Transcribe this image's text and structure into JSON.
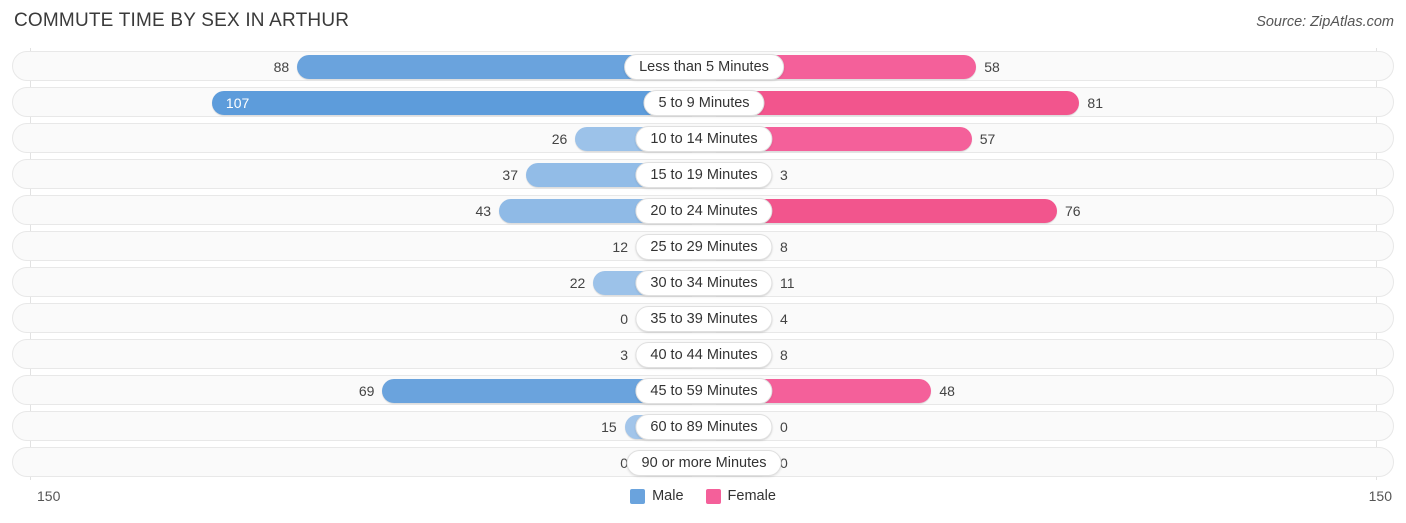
{
  "header": {
    "title": "COMMUTE TIME BY SEX IN ARTHUR",
    "source": "Source: ZipAtlas.com"
  },
  "axis": {
    "left_tick": "150",
    "right_tick": "150",
    "max": 150
  },
  "legend": {
    "items": [
      {
        "label": "Male",
        "color": "#6aa3dd"
      },
      {
        "label": "Female",
        "color": "#f4609a"
      }
    ]
  },
  "colors": {
    "male_strong": "#6aa3dd",
    "male_mid": "#8fbae6",
    "male_light": "#aecbec",
    "female_strong": "#f25d92",
    "female_mid": "#f579a8",
    "female_light": "#f9aec8",
    "track": "#fafafa",
    "track_border": "#e8e8e8"
  },
  "chart_data": {
    "type": "bar",
    "title": "COMMUTE TIME BY SEX IN ARTHUR",
    "subtitle": "",
    "orientation": "horizontal-diverging",
    "xlabel": "",
    "ylabel": "",
    "xlim": [
      150,
      150
    ],
    "grid": false,
    "legend_position": "bottom-center",
    "categories": [
      "Less than 5 Minutes",
      "5 to 9 Minutes",
      "10 to 14 Minutes",
      "15 to 19 Minutes",
      "20 to 24 Minutes",
      "25 to 29 Minutes",
      "30 to 34 Minutes",
      "35 to 39 Minutes",
      "40 to 44 Minutes",
      "45 to 59 Minutes",
      "60 to 89 Minutes",
      "90 or more Minutes"
    ],
    "series": [
      {
        "name": "Male",
        "values": [
          88,
          107,
          26,
          37,
          43,
          12,
          22,
          0,
          3,
          69,
          15,
          0
        ]
      },
      {
        "name": "Female",
        "values": [
          58,
          81,
          57,
          3,
          76,
          8,
          11,
          4,
          8,
          48,
          0,
          0
        ]
      }
    ]
  },
  "rows": [
    {
      "category": "Less than 5 Minutes",
      "male": "88",
      "female": "58",
      "male_value": 88,
      "female_value": 58,
      "male_inside": false,
      "male_color": "#6aa3dd",
      "female_color": "#f4609a"
    },
    {
      "category": "5 to 9 Minutes",
      "male": "107",
      "female": "81",
      "male_value": 107,
      "female_value": 81,
      "male_inside": true,
      "male_color": "#5d9cdb",
      "female_color": "#f2558d"
    },
    {
      "category": "10 to 14 Minutes",
      "male": "26",
      "female": "57",
      "male_value": 26,
      "female_value": 57,
      "male_inside": false,
      "male_color": "#9cc2e9",
      "female_color": "#f4609a"
    },
    {
      "category": "15 to 19 Minutes",
      "male": "37",
      "female": "3",
      "male_value": 37,
      "female_value": 3,
      "male_inside": false,
      "male_color": "#92bce7",
      "female_color": "#f9aec8"
    },
    {
      "category": "20 to 24 Minutes",
      "male": "43",
      "female": "76",
      "male_value": 43,
      "female_value": 76,
      "male_inside": false,
      "male_color": "#8fbae6",
      "female_color": "#f2558d"
    },
    {
      "category": "25 to 29 Minutes",
      "male": "12",
      "female": "8",
      "male_value": 12,
      "female_value": 8,
      "male_inside": false,
      "male_color": "#a5c7ea",
      "female_color": "#f78db2"
    },
    {
      "category": "30 to 34 Minutes",
      "male": "22",
      "female": "11",
      "male_value": 22,
      "female_value": 11,
      "male_inside": false,
      "male_color": "#9cc2e9",
      "female_color": "#f78db2"
    },
    {
      "category": "35 to 39 Minutes",
      "male": "0",
      "female": "4",
      "male_value": 0,
      "female_value": 4,
      "male_inside": false,
      "male_color": "#aecbec",
      "female_color": "#f79bbc"
    },
    {
      "category": "40 to 44 Minutes",
      "male": "3",
      "female": "8",
      "male_value": 3,
      "female_value": 8,
      "male_inside": false,
      "male_color": "#a9c8eb",
      "female_color": "#f78db2"
    },
    {
      "category": "45 to 59 Minutes",
      "male": "69",
      "female": "48",
      "male_value": 69,
      "female_value": 48,
      "male_inside": false,
      "male_color": "#6aa3dd",
      "female_color": "#f4609a"
    },
    {
      "category": "60 to 89 Minutes",
      "male": "15",
      "female": "0",
      "male_value": 15,
      "female_value": 0,
      "male_inside": false,
      "male_color": "#a2c5ea",
      "female_color": "#f9aec8"
    },
    {
      "category": "90 or more Minutes",
      "male": "0",
      "female": "0",
      "male_value": 0,
      "female_value": 0,
      "male_inside": false,
      "male_color": "#aecbec",
      "female_color": "#f9aec8"
    }
  ]
}
